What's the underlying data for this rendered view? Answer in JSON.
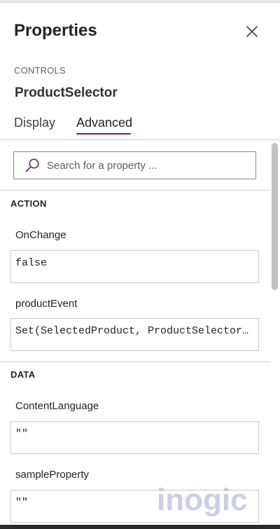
{
  "panel": {
    "title": "Properties",
    "section_label": "CONTROLS",
    "control_name": "ProductSelector",
    "close_icon": "close-icon"
  },
  "tabs": [
    {
      "label": "Display",
      "active": false
    },
    {
      "label": "Advanced",
      "active": true
    }
  ],
  "search": {
    "placeholder": "Search for a property ...",
    "value": "",
    "icon": "search-icon"
  },
  "groups": [
    {
      "title": "ACTION",
      "properties": [
        {
          "label": "OnChange",
          "value": "false"
        },
        {
          "label": "productEvent",
          "value": "Set(SelectedProduct, ProductSelector.productName)"
        }
      ]
    },
    {
      "title": "DATA",
      "properties": [
        {
          "label": "ContentLanguage",
          "value": "\"\""
        },
        {
          "label": "sampleProperty",
          "value": "\"\""
        }
      ]
    }
  ],
  "watermark": {
    "text": "inogic"
  },
  "colors": {
    "accent": "#6b1f80",
    "border": "#c8c8c8",
    "divider": "#d1d1d1",
    "watermark": "#9fa6d2"
  }
}
